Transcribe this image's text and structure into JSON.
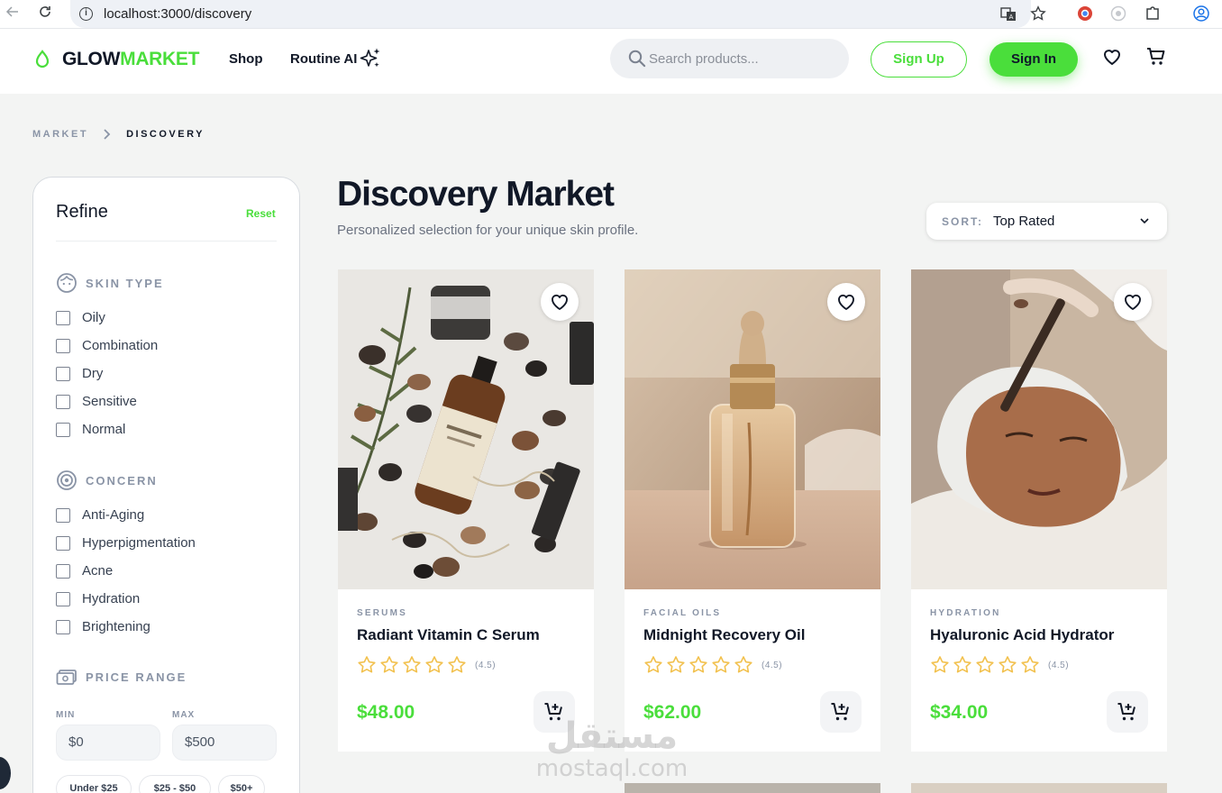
{
  "browser": {
    "url": "localhost:3000/discovery"
  },
  "header": {
    "logo_part1": "GLOW",
    "logo_part2": "MARKET",
    "nav": {
      "shop": "Shop",
      "routine_ai": "Routine AI"
    },
    "search_placeholder": "Search products...",
    "sign_up": "Sign Up",
    "sign_in": "Sign In"
  },
  "breadcrumb": {
    "items": [
      "MARKET",
      "DISCOVERY"
    ]
  },
  "sidebar": {
    "title": "Refine",
    "reset": "Reset",
    "skin_type": {
      "label": "SKIN TYPE",
      "options": [
        "Oily",
        "Combination",
        "Dry",
        "Sensitive",
        "Normal"
      ]
    },
    "concern": {
      "label": "CONCERN",
      "options": [
        "Anti-Aging",
        "Hyperpigmentation",
        "Acne",
        "Hydration",
        "Brightening"
      ]
    },
    "price_range": {
      "label": "PRICE RANGE",
      "min_label": "MIN",
      "max_label": "MAX",
      "min_value": "$0",
      "max_value": "$500",
      "chips": [
        "Under $25",
        "$25 - $50",
        "$50+"
      ]
    }
  },
  "main": {
    "title": "Discovery Market",
    "subtitle": "Personalized selection for your unique skin profile.",
    "sort": {
      "label": "SORT:",
      "value": "Top Rated"
    },
    "products": [
      {
        "category": "SERUMS",
        "name": "Radiant Vitamin C Serum",
        "rating": "(4.5)",
        "rating_value": 4.5,
        "price": "$48.00"
      },
      {
        "category": "FACIAL OILS",
        "name": "Midnight Recovery Oil",
        "rating": "(4.5)",
        "rating_value": 4.5,
        "price": "$62.00"
      },
      {
        "category": "HYDRATION",
        "name": "Hyaluronic Acid Hydrator",
        "rating": "(4.5)",
        "rating_value": 4.5,
        "price": "$34.00"
      }
    ]
  },
  "watermark": {
    "arabic": "مستقل",
    "latin": "mostaql.com"
  },
  "colors": {
    "accent": "#4ade3b",
    "star": "#f2c14e",
    "text": "#111827",
    "muted": "#8a94a6"
  },
  "icons": [
    "back-arrow-icon",
    "reload-icon",
    "info-icon",
    "translate-icon",
    "star-bookmark-icon",
    "drop-logo-icon",
    "sparkle-icon",
    "search-icon",
    "heart-icon",
    "cart-icon",
    "chevron-right-icon",
    "face-icon",
    "target-icon",
    "money-icon",
    "chevron-down-icon",
    "add-to-cart-icon"
  ]
}
